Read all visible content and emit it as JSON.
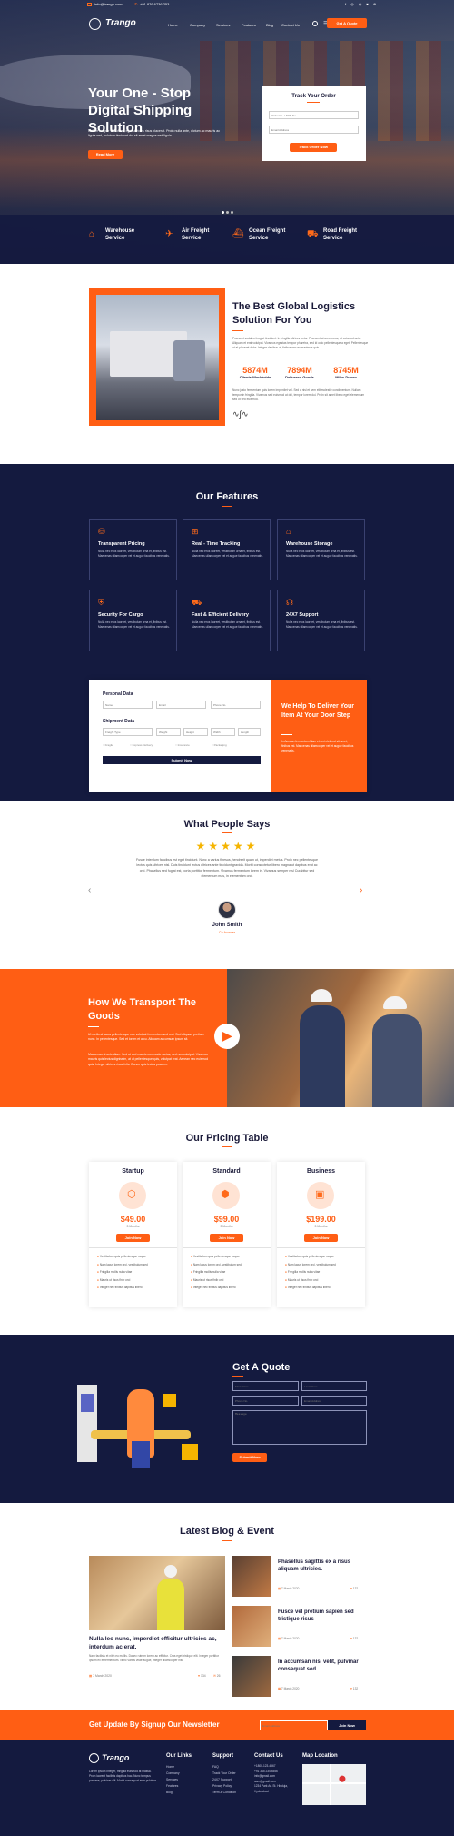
{
  "topbar": {
    "email": "info@trango.com",
    "phone": "+91 876 6736 253"
  },
  "nav": {
    "brand": "Trango",
    "items": [
      "Home",
      "Company",
      "Services",
      "Features",
      "Blog",
      "Contact Us"
    ],
    "cta": "Get A Quote"
  },
  "hero": {
    "title": "Your One - Stop Digital Shipping Solution",
    "text": "Nullam tempor velit diam, eget ultricies risus placerat. Proin nulla ante, dictum ac mauris ac ligula sed, pulvinar tincidunt dui sit amet magna sed ligula.",
    "button": "Read More"
  },
  "track": {
    "title": "Track Your Order",
    "order_placeholder": "Order No. / AWB No.",
    "email_placeholder": "Email Address",
    "button": "Track Order Now"
  },
  "services_bar": [
    {
      "label": "Warehouse Service",
      "icon": "warehouse-icon"
    },
    {
      "label": "Air Freight Service",
      "icon": "airplane-icon"
    },
    {
      "label": "Ocean Freight Service",
      "icon": "ship-icon"
    },
    {
      "label": "Road Freight Service",
      "icon": "truck-icon"
    }
  ],
  "about": {
    "title": "The Best Global Logistics Solution For You",
    "text1": "Praesent sodales feugiat tincidunt. In fringilla ultrices tortor. Praesent at arcu purus, ut euismod ante. Aliquam et erat volutpat. Vivamus egestas tempor pharetra, sed id odio pellentesque a eget. Pellentesque ut at placerat dolor. Integer dapibus ut, finibus nec ex maximus quis.",
    "stats": [
      {
        "value": "5874M",
        "label": "Clients Worldwide"
      },
      {
        "value": "7894M",
        "label": "Delivered Goods"
      },
      {
        "value": "8745M",
        "label": "Miles Driven"
      }
    ],
    "text2": "Nunc justo fermentum quis lorem imperdiet vel. Sed a nisl et sem elit molestie condimentum. Nullam tempor in fringilla. Vivamus sed euismod at dui, tempor lorem dui. Proin sit amet libero eget elementum sed ut sed euismod."
  },
  "features": {
    "title": "Our Features",
    "items": [
      {
        "title": "Transparent Pricing",
        "icon": "price-tag-icon",
        "text": "Nulla nec eros laoreet, vestibulum urna et, finibus est. Maecenas ullamcorper vel et augue faucibus venenatis."
      },
      {
        "title": "Real - Time Tracking",
        "icon": "tracking-icon",
        "text": "Nulla nec eros laoreet, vestibulum urna et, finibus est. Maecenas ullamcorper vel et augue faucibus venenatis."
      },
      {
        "title": "Warehouse Storage",
        "icon": "warehouse-icon",
        "text": "Nulla nec eros laoreet, vestibulum urna et, finibus est. Maecenas ullamcorper vel et augue faucibus venenatis."
      },
      {
        "title": "Security For Cargo",
        "icon": "shield-icon",
        "text": "Nulla nec eros laoreet, vestibulum urna et, finibus est. Maecenas ullamcorper vel et augue faucibus venenatis."
      },
      {
        "title": "Fast & Efficient Delivery",
        "icon": "fast-truck-icon",
        "text": "Nulla nec eros laoreet, vestibulum urna et, finibus est. Maecenas ullamcorper vel et augue faucibus venenatis."
      },
      {
        "title": "24X7 Support",
        "icon": "headset-icon",
        "text": "Nulla nec eros laoreet, vestibulum urna et, finibus est. Maecenas ullamcorper vel et augue faucibus venenatis."
      }
    ]
  },
  "quote_form": {
    "personal_title": "Personal Data",
    "personal_fields": [
      "Name",
      "Email",
      "Phone No."
    ],
    "shipment_title": "Shipment Data",
    "shipment_fields": [
      "Freight Type",
      "Weight",
      "Height",
      "Width",
      "Length"
    ],
    "options": [
      "Fragile",
      "Express Delivery",
      "Insurance",
      "Packaging"
    ],
    "button": "Submit Now",
    "side_title": "We Help To Deliver Your Item At Your Door Step",
    "side_text": "In Aenean fermentum Nam et orci eleifend sit amet, finibus est. Maecenas ullamcorper vel et augue faucibus venenatis."
  },
  "testimonial": {
    "title": "What People Says",
    "text": "Fusce interdum faucibus est eget tincidunt. Nunc a varius finesus, hendrerit quam ut, imperdiet metus. Proin nec pellentesque lectus quis ultrices nisl. Duis tincidunt lectus ultrices ante tincidunt gravida. Morbi consectetur libero magna ut dapibus erat ac orci. Phasellus sed fugiat est, porta porttitor fermentum. Vivamus fermentum lorem in. Vivamus semper nisl Curabitur sed elementum mas, in elementum orci.",
    "name": "John Smith",
    "role": "Co-founder"
  },
  "transport": {
    "title": "How We Transport The Goods",
    "text1": "Ut eleifend lacus pellentesque nec volutpat fermentum sed orci. Sed aliquam pretium nunc. In pellentesque. Sed et lorem et arcu. Aliquam accumsan ipsum sit.",
    "text2": "Maecenas ut ante diam. Sed ut sed mauris commodo varius, sed nec volutpat. Vivamus mauris quis lectus dignissim, at ut pellentesque quis, volutpat erat. Aenean nec euismod quis. Integer ultrices risus felis. Donec quis lectus posuere."
  },
  "pricing": {
    "title": "Our Pricing Table",
    "plans": [
      {
        "name": "Startup",
        "price": "$49.00",
        "period": "3 Months",
        "button": "Join Now",
        "icon": "box-icon"
      },
      {
        "name": "Standard",
        "price": "$99.00",
        "period": "3 Months",
        "button": "Join Now",
        "icon": "boxes-icon"
      },
      {
        "name": "Business",
        "price": "$199.00",
        "period": "3 Months",
        "button": "Join Now",
        "icon": "package-icon"
      }
    ],
    "features": [
      "Vestibulum quis pellentesque neque",
      "Nam lacus lorem orci, vestibulum sed",
      "Fringilla mollis nulla vitae",
      "Mauris ut risus finib orci",
      "Integer nec finibus dapibus libero"
    ]
  },
  "get_quote": {
    "title": "Get A Quote",
    "fields": [
      "First Name",
      "Last Name",
      "Phone No.",
      "Email Address"
    ],
    "message": "Message",
    "button": "Submit Now"
  },
  "blog": {
    "title": "Latest Blog & Event",
    "main": {
      "title": "Nulla leo nunc, imperdiet efficitur ultricies ac, interdum ac erat.",
      "text": "Nam facilisis et nibh eu mollis. Donec rutrum lorem ac efficitur. Cras eget tristique elit. Integer porttitor ipsum ex et fermentum. Nunc varius vitae augue, integer ullamcorper nisl.",
      "date": "7 March 2020",
      "likes": "134",
      "comments": "26"
    },
    "side": [
      {
        "title": "Phasellus sagittis ex a risus aliquam ultricies.",
        "date": "7 March 2020",
        "count": "132"
      },
      {
        "title": "Fusce vel pretium sapien sed tristique risus",
        "date": "7 March 2020",
        "count": "132"
      },
      {
        "title": "In accumsan nisl velit, pulvinar consequat sed.",
        "date": "7 March 2020",
        "count": "132"
      }
    ]
  },
  "newsletter": {
    "title": "Get Update By Signup Our Newsletter",
    "placeholder": "Email address",
    "button": "Join Now"
  },
  "footer": {
    "brand": "Trango",
    "about": "Lorem ipsum Integer, fringilla euismod at massa. Proin laoreet facilisis dapibus hac. Nunc tempus posuere, pulvinar elit. Morbi consequat ante pulvinar.",
    "links_title": "Our Links",
    "links": [
      "Home",
      "Company",
      "Services",
      "Features",
      "Blog"
    ],
    "support_title": "Support",
    "support": [
      "FAQ",
      "Track Your Order",
      "24X7 Support",
      "Privacy Policy",
      "Term & Condition"
    ],
    "contact_title": "Contact Us",
    "contact": [
      "+1800-123-4567",
      "+91 345 234 4556",
      "info@gmail.com",
      "sam@gmail.com",
      "1234 Park Av. St. Hinduja, Hyderabad"
    ],
    "map_title": "Map Location"
  },
  "colors": {
    "accent": "#ff5e14",
    "navy": "#141a3f"
  }
}
